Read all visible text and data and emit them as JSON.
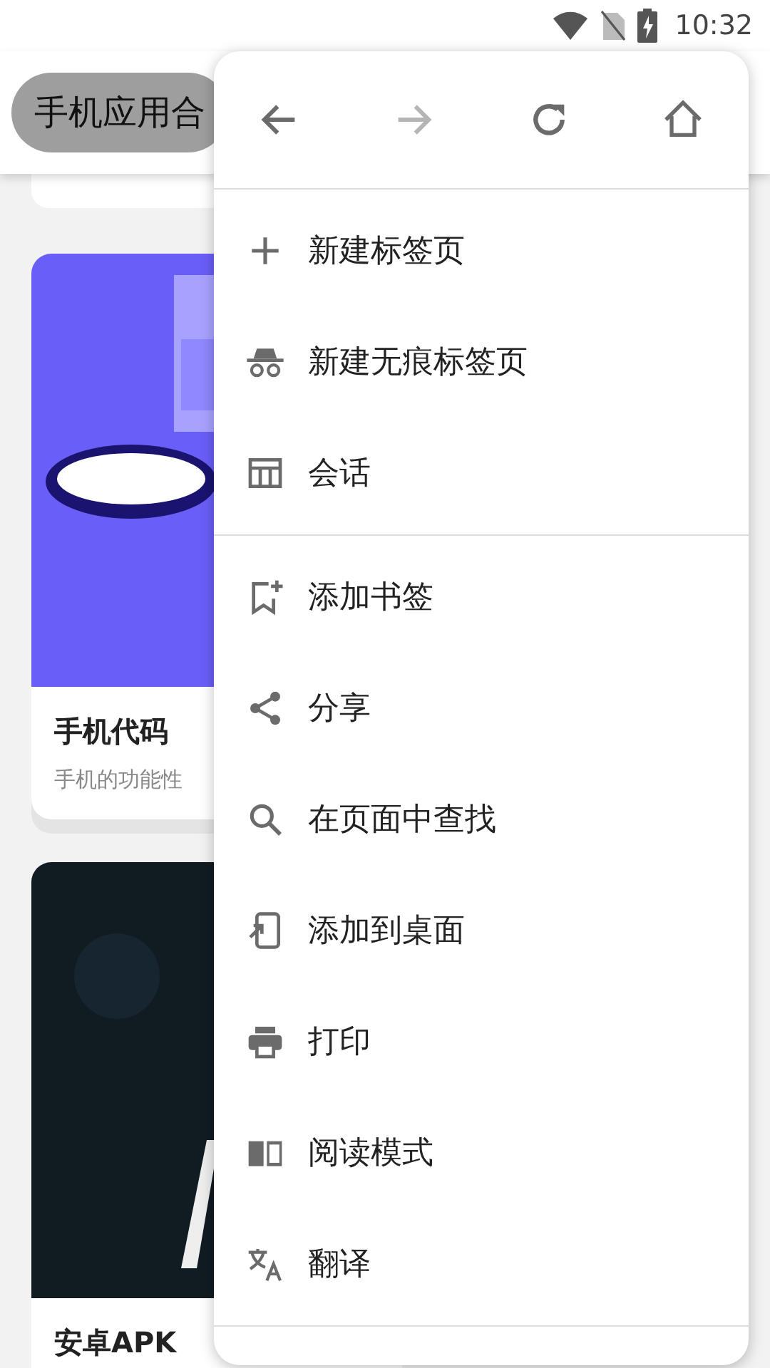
{
  "status_bar": {
    "time": "10:32"
  },
  "page": {
    "header_title": "手机应用合",
    "cards": [
      {
        "title": "手机代码",
        "subtitle": "手机的功能性"
      },
      {
        "title": "安卓APK"
      }
    ]
  },
  "menu": {
    "nav_buttons": [
      {
        "disabled": false
      },
      {
        "disabled": true
      },
      {
        "disabled": false
      },
      {
        "disabled": false
      }
    ],
    "sections": [
      {
        "items": [
          {
            "label": "新建标签页"
          },
          {
            "label": "新建无痕标签页"
          },
          {
            "label": "会话"
          }
        ]
      },
      {
        "items": [
          {
            "label": "添加书签"
          },
          {
            "label": "分享"
          },
          {
            "label": "在页面中查找"
          },
          {
            "label": "添加到桌面"
          },
          {
            "label": "打印"
          },
          {
            "label": "阅读模式"
          },
          {
            "label": "翻译"
          }
        ]
      }
    ]
  }
}
